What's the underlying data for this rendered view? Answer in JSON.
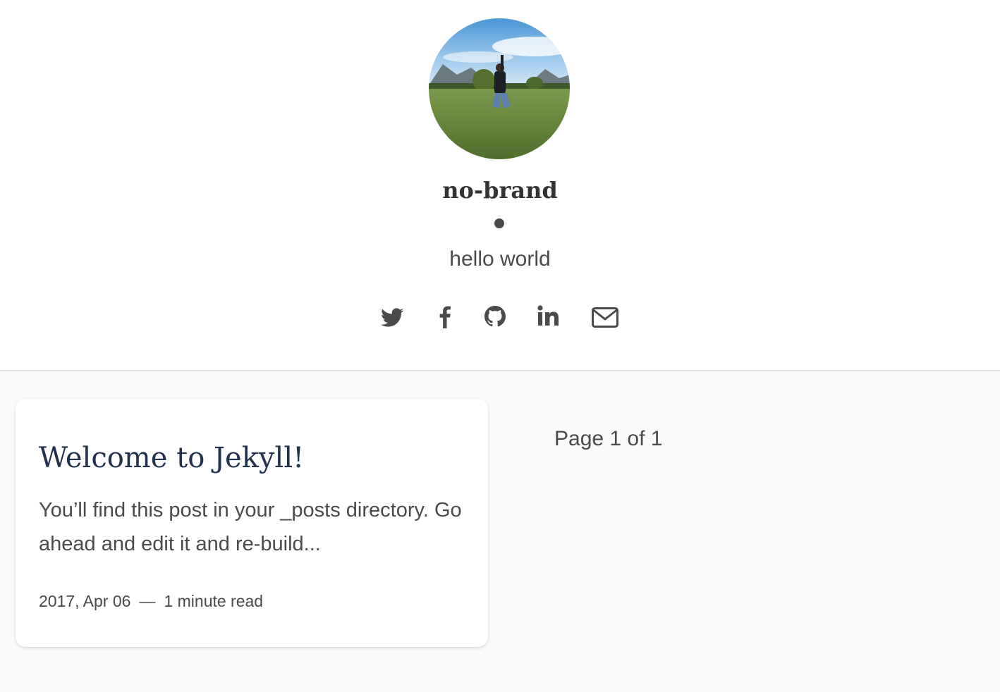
{
  "site": {
    "name": "no-brand",
    "tagline": "hello world",
    "avatar_alt": "avatar"
  },
  "social": [
    {
      "name": "twitter",
      "icon": "twitter-icon"
    },
    {
      "name": "facebook",
      "icon": "facebook-icon"
    },
    {
      "name": "github",
      "icon": "github-icon"
    },
    {
      "name": "linkedin",
      "icon": "linkedin-icon"
    },
    {
      "name": "email",
      "icon": "envelope-icon"
    }
  ],
  "posts": [
    {
      "title": "Welcome to Jekyll!",
      "excerpt": "You’ll find this post in your _posts directory. Go ahead and edit it and re-build...",
      "date": "2017, Apr 06",
      "separator": "—",
      "read_time": "1 minute read"
    }
  ],
  "pagination": {
    "label": "Page 1 of 1"
  },
  "colors": {
    "title": "#22324d",
    "text": "#4a4a4a",
    "background": "#fafafa",
    "header_bg": "#ffffff"
  }
}
